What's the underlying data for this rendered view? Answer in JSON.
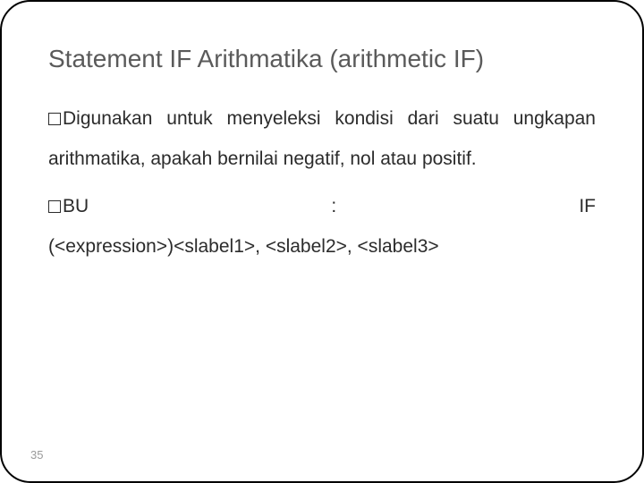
{
  "slide": {
    "title": "Statement IF Arithmatika (arithmetic IF)",
    "bullets": [
      {
        "lead": "Digunakan",
        "rest_first_line": " untuk menyeleksi kondisi dari suatu",
        "cont1": "ungkapan arithmatika, apakah bernilai negatif, nol",
        "cont2": "atau positif."
      },
      {
        "left": "BU",
        "mid": ":",
        "right": "IF",
        "cont1": "(<expression>)<slabel1>, <slabel2>, <slabel3>"
      }
    ],
    "page_number": "35"
  }
}
